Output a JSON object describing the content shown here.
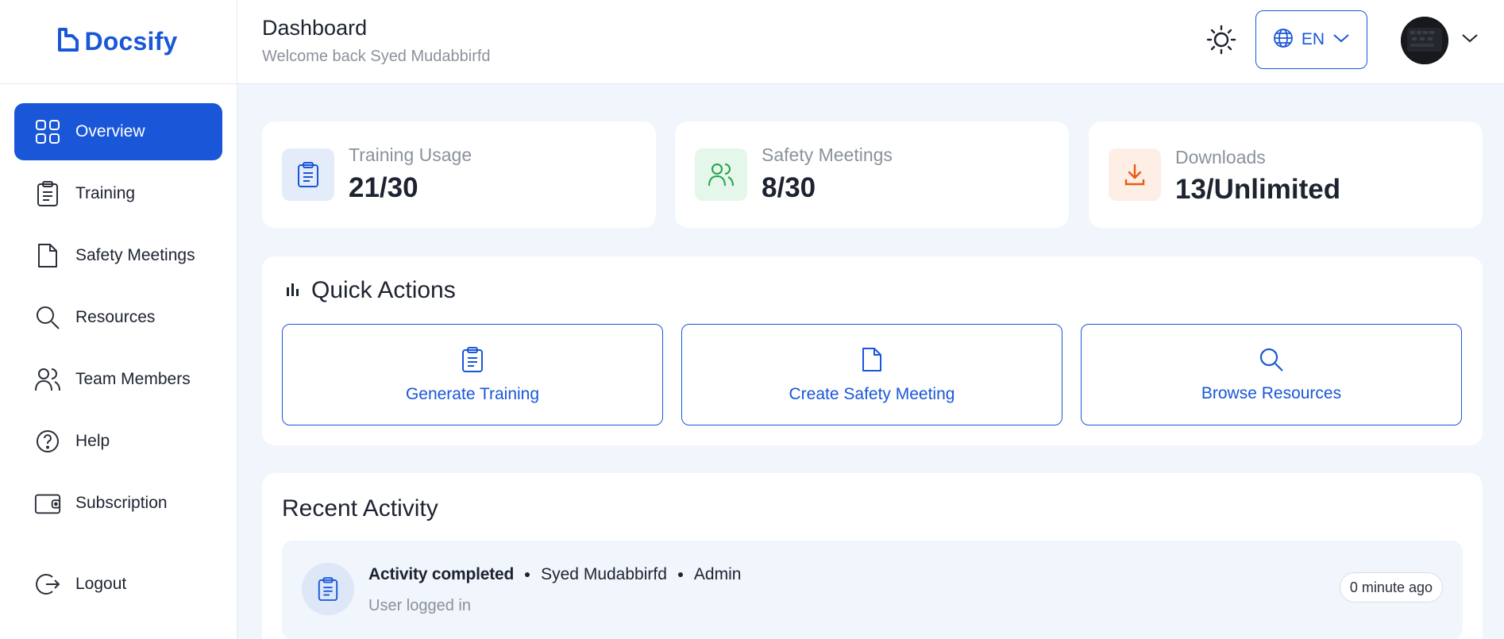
{
  "brand": {
    "name": "Docsify",
    "color": "#1957d8"
  },
  "sidebar": {
    "items": [
      {
        "label": "Overview",
        "icon": "grid-icon",
        "active": true
      },
      {
        "label": "Training",
        "icon": "clipboard-icon"
      },
      {
        "label": "Safety Meetings",
        "icon": "file-icon"
      },
      {
        "label": "Resources",
        "icon": "search-icon"
      },
      {
        "label": "Team Members",
        "icon": "users-icon"
      },
      {
        "label": "Help",
        "icon": "help-circle-icon"
      },
      {
        "label": "Subscription",
        "icon": "wallet-icon"
      }
    ],
    "logout_label": "Logout"
  },
  "header": {
    "title": "Dashboard",
    "subtitle": "Welcome back Syed Mudabbirfd",
    "language": "EN",
    "theme_icon": "sun-moon-icon"
  },
  "stats": [
    {
      "label": "Training Usage",
      "value": "21/30",
      "icon": "clipboard-icon",
      "color": "#1957d8",
      "bg": "#e4ebf9"
    },
    {
      "label": "Safety Meetings",
      "value": "8/30",
      "icon": "users-icon",
      "color": "#22a24a",
      "bg": "#e5f6ea"
    },
    {
      "label": "Downloads",
      "value": "13/Unlimited",
      "icon": "download-icon",
      "color": "#ea5a12",
      "bg": "#fdeee6"
    }
  ],
  "quick_actions": {
    "title": "Quick Actions",
    "buttons": [
      {
        "label": "Generate Training",
        "icon": "clipboard-icon"
      },
      {
        "label": "Create Safety Meeting",
        "icon": "file-icon"
      },
      {
        "label": "Browse Resources",
        "icon": "search-icon"
      }
    ]
  },
  "recent_activity": {
    "title": "Recent Activity",
    "items": [
      {
        "title": "Activity completed",
        "user": "Syed Mudabbirfd",
        "role": "Admin",
        "description": "User logged in",
        "time": "0 minute ago"
      }
    ]
  }
}
